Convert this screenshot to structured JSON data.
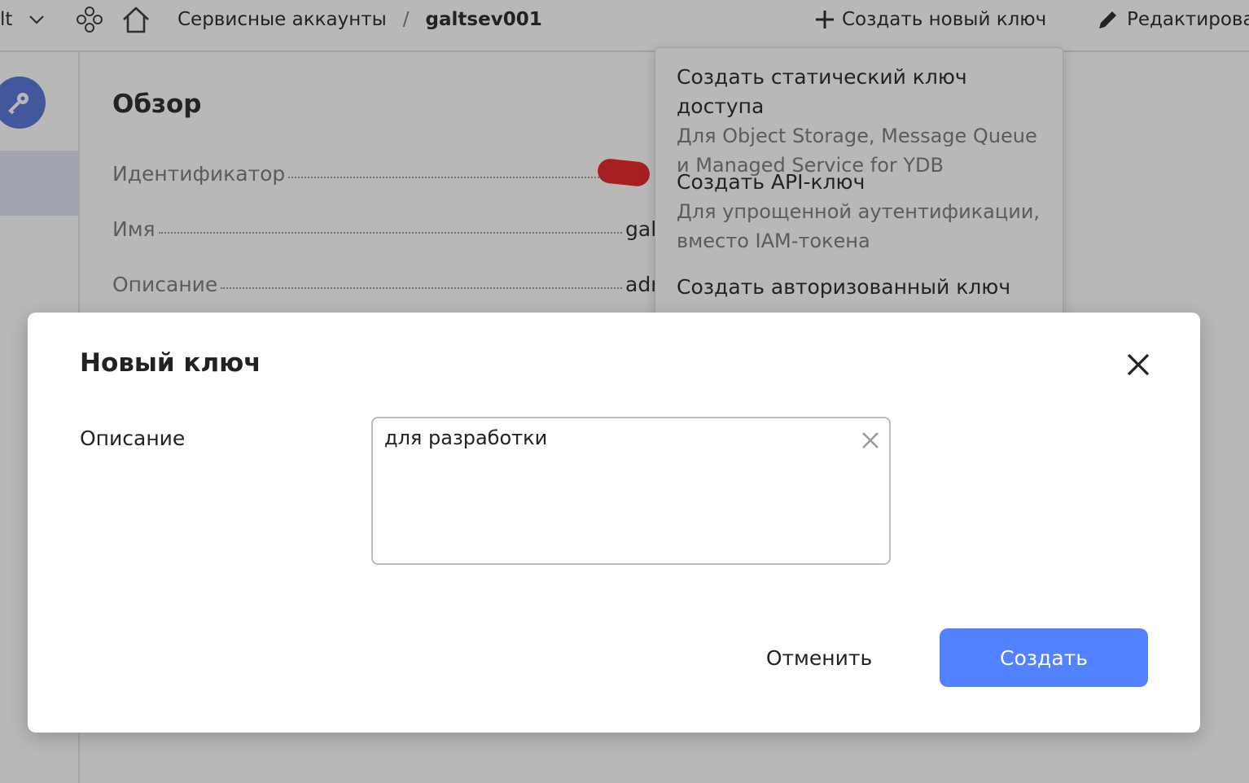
{
  "topbar": {
    "folder_label": "lt",
    "breadcrumb": [
      "Сервисные аккаунты",
      "galtsev001"
    ],
    "separator": "/",
    "create_key_label": "Создать новый ключ",
    "edit_label": "Редактирова"
  },
  "overview": {
    "title": "Обзор",
    "properties": [
      {
        "label": "Идентификатор",
        "value": ""
      },
      {
        "label": "Имя",
        "value": "galtse"
      },
      {
        "label": "Описание",
        "value": "admir"
      }
    ]
  },
  "create_key_menu": {
    "items": [
      {
        "title": "Создать статический ключ доступа",
        "desc": "Для Object Storage, Message Queue и Managed Service for YDB"
      },
      {
        "title": "Создать API-ключ",
        "desc": "Для упрощенной аутентификации, вместо IAM-токена"
      },
      {
        "title": "Создать авторизованный ключ",
        "desc": ""
      }
    ]
  },
  "modal": {
    "title": "Новый ключ",
    "description_label": "Описание",
    "description_value": "для разработки",
    "cancel_label": "Отменить",
    "create_label": "Создать"
  },
  "colors": {
    "primary": "#5282ff",
    "overlay": "rgba(40,40,40,0.33)",
    "sidebar_icon": "#4f6fd6"
  }
}
